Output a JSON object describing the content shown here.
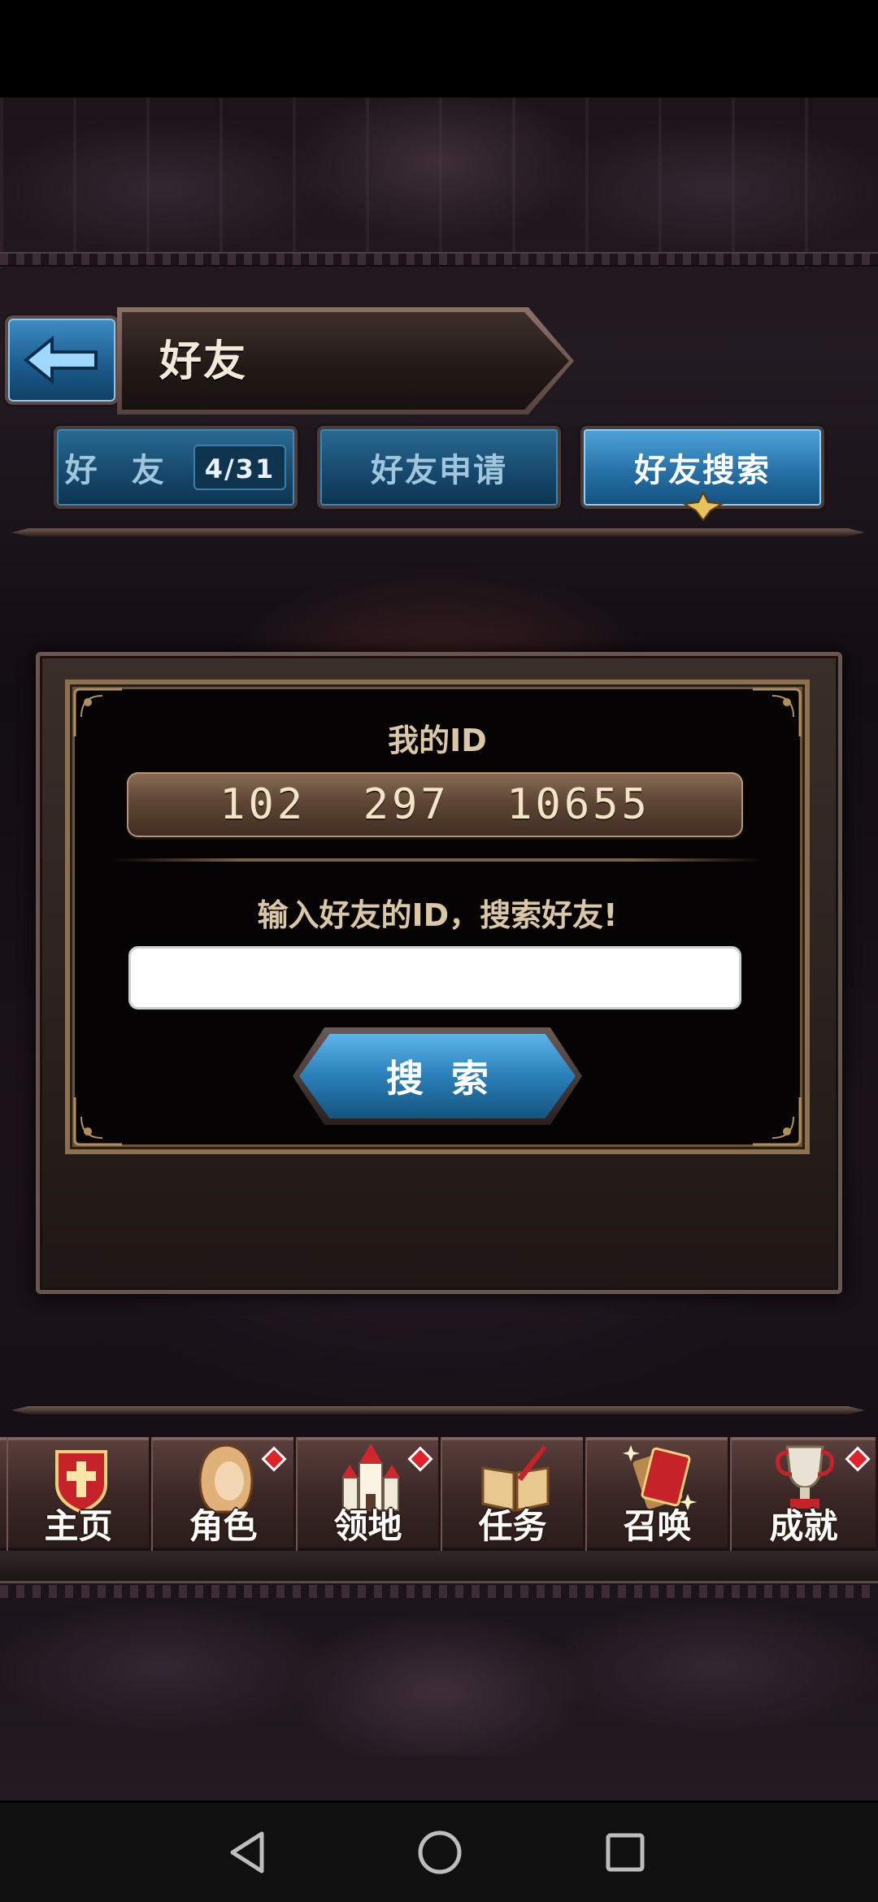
{
  "header": {
    "title": "好友"
  },
  "tabs": {
    "friends": {
      "label": "好 友",
      "count": "4/31"
    },
    "requests": {
      "label": "好友申请"
    },
    "search": {
      "label": "好友搜索",
      "active": true
    }
  },
  "search_panel": {
    "my_id_label": "我的ID",
    "my_id_value": "102  297  10655",
    "prompt": "输入好友的ID，搜索好友!",
    "input_value": "",
    "input_placeholder": "",
    "search_button_label": "搜索"
  },
  "bottom_nav": {
    "items": [
      {
        "label": "主页",
        "icon": "home-shield-icon",
        "badge": false
      },
      {
        "label": "角色",
        "icon": "character-icon",
        "badge": true
      },
      {
        "label": "领地",
        "icon": "castle-icon",
        "badge": true
      },
      {
        "label": "任务",
        "icon": "quest-book-icon",
        "badge": false
      },
      {
        "label": "召唤",
        "icon": "summon-cards-icon",
        "badge": false
      },
      {
        "label": "成就",
        "icon": "trophy-icon",
        "badge": true
      }
    ]
  },
  "colors": {
    "tab_active": "#2672a8",
    "tab_inactive": "#174a6e",
    "badge_red": "#e0222a",
    "panel_gold": "#8c7150"
  },
  "system_nav": {
    "icons": [
      "back-triangle-icon",
      "home-circle-icon",
      "recents-square-icon"
    ]
  }
}
